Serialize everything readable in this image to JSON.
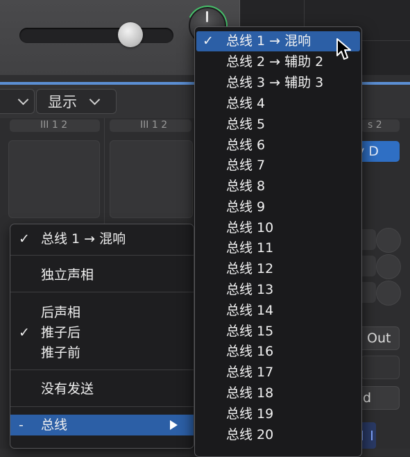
{
  "toolbar": {
    "show_label": "显示"
  },
  "strips": {
    "channel_labels": [
      "III 1 2",
      "III 1 2",
      "s 2"
    ],
    "blue_button": "y D",
    "out_button": "Out",
    "d_button": "d"
  },
  "context_menu": {
    "items": [
      {
        "label": "总线 1 → 混响",
        "checked": true
      },
      {
        "label": "独立声相",
        "checked": false
      },
      {
        "label": "后声相",
        "checked": false
      },
      {
        "label": "推子后",
        "checked": true
      },
      {
        "label": "推子前",
        "checked": false
      },
      {
        "label": "没有发送",
        "checked": false
      },
      {
        "label": "总线",
        "prefix": "-",
        "has_submenu": true
      }
    ],
    "check_mark": "✓"
  },
  "bus_submenu": {
    "items": [
      {
        "label": "总线 1 → 混响",
        "checked": true
      },
      {
        "label": "总线 2 → 辅助 2"
      },
      {
        "label": "总线 3 → 辅助 3"
      },
      {
        "label": "总线 4"
      },
      {
        "label": "总线 5"
      },
      {
        "label": "总线 6"
      },
      {
        "label": "总线 7"
      },
      {
        "label": "总线 8"
      },
      {
        "label": "总线 9"
      },
      {
        "label": "总线 10"
      },
      {
        "label": "总线 11"
      },
      {
        "label": "总线 12"
      },
      {
        "label": "总线 13"
      },
      {
        "label": "总线 14"
      },
      {
        "label": "总线 15"
      },
      {
        "label": "总线 16"
      },
      {
        "label": "总线 17"
      },
      {
        "label": "总线 18"
      },
      {
        "label": "总线 19"
      },
      {
        "label": "总线 20"
      }
    ],
    "check_mark": "✓"
  },
  "colors": {
    "highlight": "#2c5fa6",
    "accent_line": "#5b8fd4",
    "knob_ring": "#46c06a"
  }
}
